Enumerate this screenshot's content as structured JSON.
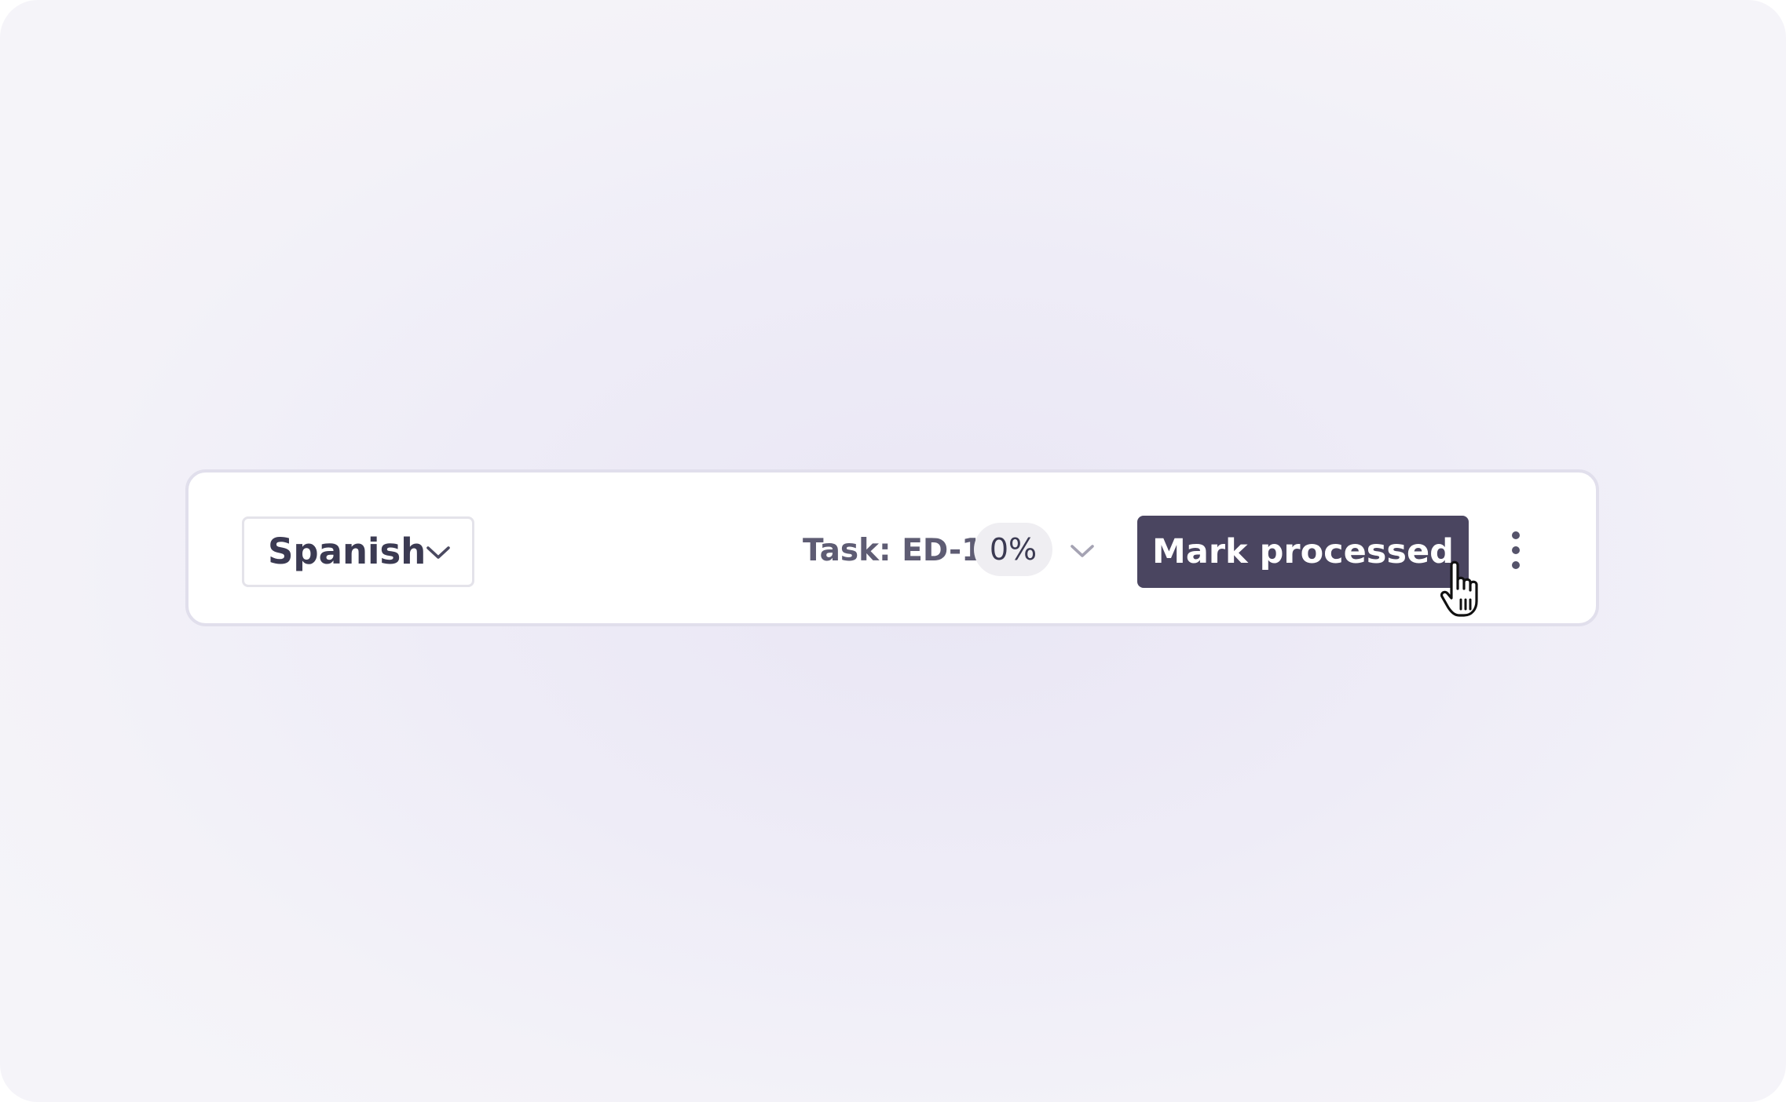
{
  "toolbar": {
    "language_select": {
      "value": "Spanish",
      "icon": "chevron-down-icon"
    },
    "task": {
      "label": "Task: ED-1",
      "progress": "0%",
      "dropdown_icon": "chevron-down-icon"
    },
    "primary_action": {
      "label": "Mark processed"
    },
    "more_icon": "more-vertical-icon"
  },
  "cursor": {
    "icon": "hand-pointer-icon"
  },
  "colors": {
    "primary_button_bg": "#4a4560",
    "primary_button_text": "#ffffff",
    "text_primary": "#3b3a52",
    "text_secondary": "#5e5c73",
    "badge_bg": "#efeef2",
    "toolbar_border": "#e1dfec",
    "background": "#eeecf7"
  }
}
